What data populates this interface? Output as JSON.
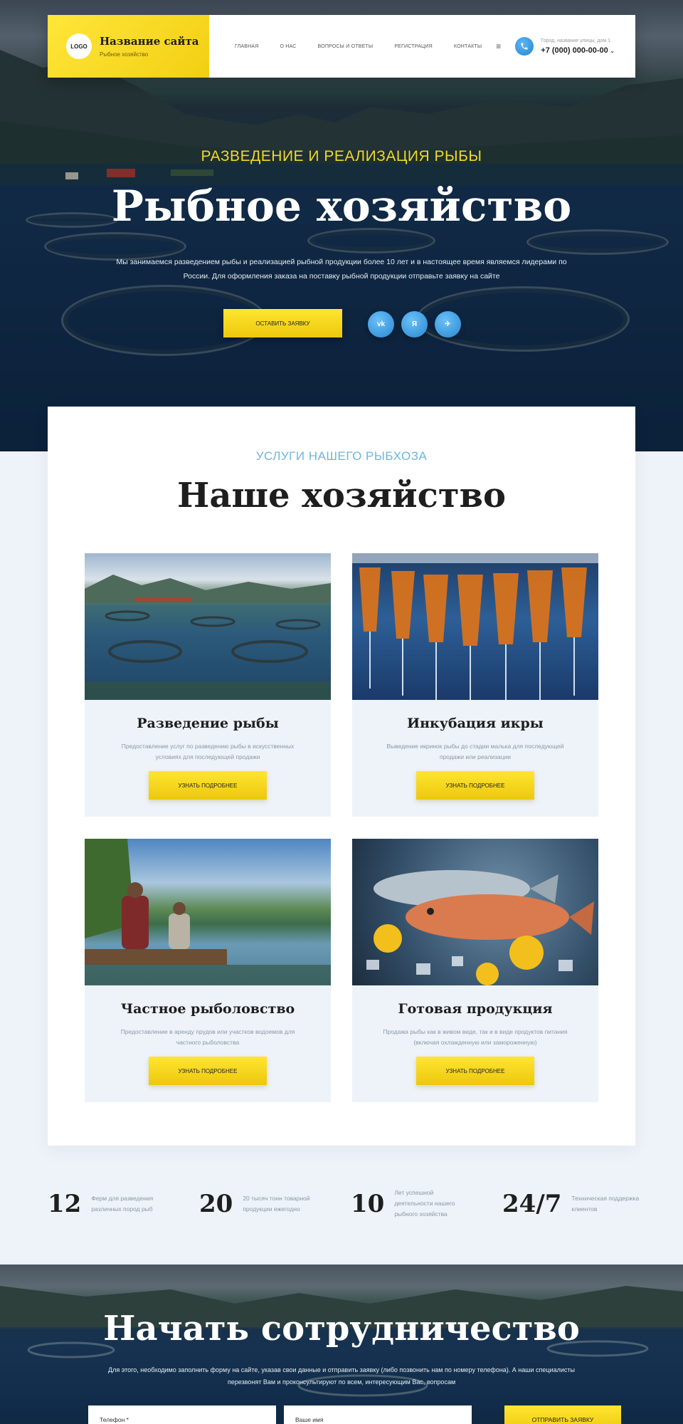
{
  "header": {
    "logo_text": "LOGO",
    "site_name": "Название сайта",
    "site_subtitle": "Рыбное хозяйство",
    "nav": [
      "ГЛАВНАЯ",
      "О НАС",
      "ВОПРОСЫ И ОТВЕТЫ",
      "РЕГИСТРАЦИЯ",
      "КОНТАКТЫ"
    ],
    "menu_icon": "≡",
    "address": "Город, название улицы, дом 1",
    "phone": "+7 (000) 000-00-00",
    "phone_chevron": "⌄"
  },
  "hero": {
    "subtitle": "РАЗВЕДЕНИЕ И РЕАЛИЗАЦИЯ РЫБЫ",
    "title": "Рыбное хозяйство",
    "text": "Мы занимаемся разведением рыбы и реализацией рыбной продукции более 10 лет и в настоящее время являемся лидерами по России. Для оформления заказа на поставку рыбной продукции отправьте заявку на сайте",
    "cta_label": "ОСТАВИТЬ ЗАЯВКУ",
    "socials": [
      "vk",
      "Я",
      "✈"
    ]
  },
  "services": {
    "subtitle": "УСЛУГИ НАШЕГО РЫБХОЗА",
    "title": "Наше хозяйство",
    "cards": [
      {
        "title": "Разведение рыбы",
        "text": "Предоставление услуг по разведению рыбы в искусственных условиях для последующей продажи",
        "button": "УЗНАТЬ ПОДРОБНЕЕ"
      },
      {
        "title": "Инкубация икры",
        "text": "Выведение икринок рыбы до стадии малька для последующей продажи или реализации",
        "button": "УЗНАТЬ ПОДРОБНЕЕ"
      },
      {
        "title": "Частное рыболовство",
        "text": "Предоставление в аренду прудов или участков водоемов для частного рыболовства",
        "button": "УЗНАТЬ ПОДРОБНЕЕ"
      },
      {
        "title": "Готовая продукция",
        "text": "Продажа рыбы как в живом виде, так и в виде продуктов питания (включая охлажденную или замороженную)",
        "button": "УЗНАТЬ ПОДРОБНЕЕ"
      }
    ]
  },
  "stats": [
    {
      "number": "12",
      "text": "Ферм для разведения различных пород рыб"
    },
    {
      "number": "20",
      "text": "20 тысяч тонн товарной продукции ежегодно"
    },
    {
      "number": "10",
      "text": "Лет успешной деятельности нашего рыбного хозяйства"
    },
    {
      "number": "24/7",
      "text": "Техническая поддержка клиентов"
    }
  ],
  "cooperation": {
    "title": "Начать сотрудничество",
    "text": "Для этого, необходимо заполнить форму на сайте, указав свои данные и отправить заявку (либо позвонить нам по номеру телефона). А наши специалисты перезвонят Вам и проконсультируют по всем, интересующим Вас, вопросам",
    "phone_placeholder": "Телефон *",
    "name_placeholder": "Ваше имя",
    "submit_label": "ОТПРАВИТЬ ЗАЯВКУ"
  },
  "colors": {
    "accent_yellow": "#f2cf12",
    "accent_blue": "#2788d3",
    "subtitle_blue": "#6fb4df"
  }
}
